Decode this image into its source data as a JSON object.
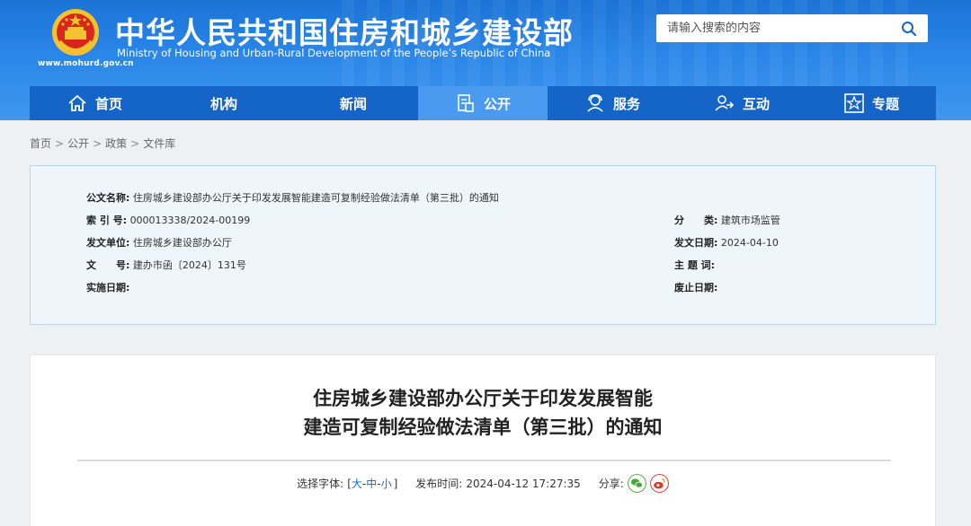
{
  "header": {
    "title": "中华人民共和国住房和城乡建设部",
    "subtitle": "Ministry of Housing and Urban-Rural Development of the People’s Republic of China",
    "url": "www.mohurd.gov.cn",
    "emblem_icon": "national-emblem-icon"
  },
  "search": {
    "placeholder": "请输入搜索的内容",
    "icon": "search-icon"
  },
  "nav": {
    "items": [
      {
        "label": "首页",
        "icon": "home-icon"
      },
      {
        "label": "机构"
      },
      {
        "label": "新闻"
      },
      {
        "label": "公开",
        "icon": "document-icon",
        "active": true
      },
      {
        "label": "服务",
        "icon": "service-icon"
      },
      {
        "label": "互动",
        "icon": "interaction-icon"
      },
      {
        "label": "专题",
        "icon": "star-icon"
      }
    ]
  },
  "breadcrumb": [
    "首页",
    "公开",
    "政策",
    "文件库"
  ],
  "info": {
    "doc_name_label": "公文名称:",
    "doc_name": "住房城乡建设部办公厅关于印发发展智能建造可复制经验做法清单（第三批）的通知",
    "index_label": "索 引 号:",
    "index": "000013338/2024-00199",
    "category_label": "分　　类:",
    "category": "建筑市场监管",
    "issuer_label": "发文单位:",
    "issuer": "住房城乡建设部办公厅",
    "issue_date_label": "发文日期:",
    "issue_date": "2024-04-10",
    "doc_no_label": "文　　号:",
    "doc_no": "建办市函〔2024〕131号",
    "keywords_label": "主 题 词:",
    "keywords": "",
    "effective_label": "实施日期:",
    "effective": "",
    "expiry_label": "废止日期:",
    "expiry": ""
  },
  "article": {
    "title_line1": "住房城乡建设部办公厅关于印发发展智能",
    "title_line2": "建造可复制经验做法清单（第三批）的通知",
    "font_label": "选择字体:",
    "font_open": "[",
    "font_large": "大",
    "font_medium": "中",
    "font_small": "小",
    "font_close": "]",
    "font_dash": "-",
    "publish_label": "发布时间:",
    "publish_time": "2024-04-12 17:27:35",
    "share_label": "分享:",
    "share_wechat_icon": "wechat-icon",
    "share_weibo_icon": "weibo-icon"
  },
  "colors": {
    "header_blue": "#2a86e8",
    "nav_blue": "#1565c8",
    "nav_active": "#4a9bf0",
    "link_blue": "#1a66c7",
    "info_bg": "#eef5fb"
  }
}
